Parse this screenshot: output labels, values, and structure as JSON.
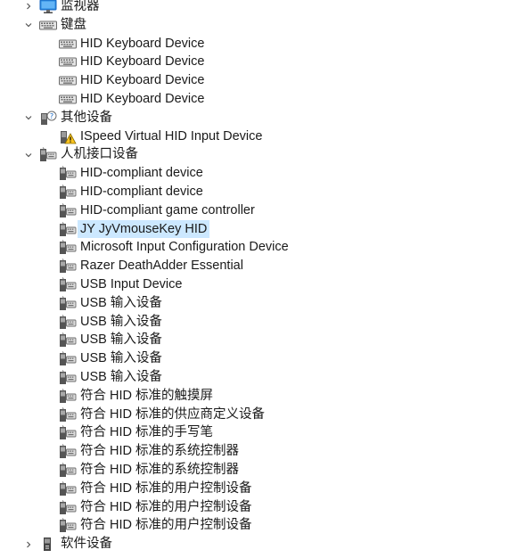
{
  "tree": [
    {
      "level": 0,
      "expanded": false,
      "icon": "monitor-icon",
      "label": "监视器"
    },
    {
      "level": 0,
      "expanded": true,
      "icon": "keyboard-icon",
      "label": "键盘"
    },
    {
      "level": 1,
      "icon": "keyboard-icon",
      "label": "HID Keyboard Device"
    },
    {
      "level": 1,
      "icon": "keyboard-icon",
      "label": "HID Keyboard Device"
    },
    {
      "level": 1,
      "icon": "keyboard-icon",
      "label": "HID Keyboard Device"
    },
    {
      "level": 1,
      "icon": "keyboard-icon",
      "label": "HID Keyboard Device"
    },
    {
      "level": 0,
      "expanded": true,
      "icon": "other-device-icon",
      "label": "其他设备"
    },
    {
      "level": 1,
      "icon": "warning-device-icon",
      "label": "ISpeed Virtual HID Input Device"
    },
    {
      "level": 0,
      "expanded": true,
      "icon": "hid-icon",
      "label": "人机接口设备"
    },
    {
      "level": 1,
      "icon": "hid-icon",
      "label": "HID-compliant device"
    },
    {
      "level": 1,
      "icon": "hid-icon",
      "label": "HID-compliant device"
    },
    {
      "level": 1,
      "icon": "hid-icon",
      "label": "HID-compliant game controller"
    },
    {
      "level": 1,
      "icon": "hid-icon",
      "label": "JY JyVmouseKey HID",
      "selected": true
    },
    {
      "level": 1,
      "icon": "hid-icon",
      "label": "Microsoft Input Configuration Device"
    },
    {
      "level": 1,
      "icon": "hid-icon",
      "label": "Razer DeathAdder Essential"
    },
    {
      "level": 1,
      "icon": "hid-icon",
      "label": "USB Input Device"
    },
    {
      "level": 1,
      "icon": "hid-icon",
      "label": "USB 输入设备"
    },
    {
      "level": 1,
      "icon": "hid-icon",
      "label": "USB 输入设备"
    },
    {
      "level": 1,
      "icon": "hid-icon",
      "label": "USB 输入设备"
    },
    {
      "level": 1,
      "icon": "hid-icon",
      "label": "USB 输入设备"
    },
    {
      "level": 1,
      "icon": "hid-icon",
      "label": "USB 输入设备"
    },
    {
      "level": 1,
      "icon": "hid-icon",
      "label": "符合 HID 标准的触摸屏"
    },
    {
      "level": 1,
      "icon": "hid-icon",
      "label": "符合 HID 标准的供应商定义设备"
    },
    {
      "level": 1,
      "icon": "hid-icon",
      "label": "符合 HID 标准的手写笔"
    },
    {
      "level": 1,
      "icon": "hid-icon",
      "label": "符合 HID 标准的系统控制器"
    },
    {
      "level": 1,
      "icon": "hid-icon",
      "label": "符合 HID 标准的系统控制器"
    },
    {
      "level": 1,
      "icon": "hid-icon",
      "label": "符合 HID 标准的用户控制设备"
    },
    {
      "level": 1,
      "icon": "hid-icon",
      "label": "符合 HID 标准的用户控制设备"
    },
    {
      "level": 1,
      "icon": "hid-icon",
      "label": "符合 HID 标准的用户控制设备"
    },
    {
      "level": 0,
      "expanded": false,
      "icon": "software-device-icon",
      "label": "软件设备"
    }
  ],
  "colors": {
    "selection": "#cce8ff",
    "monitor": "#1e88e5",
    "icon_gray": "#6b6b6b"
  }
}
